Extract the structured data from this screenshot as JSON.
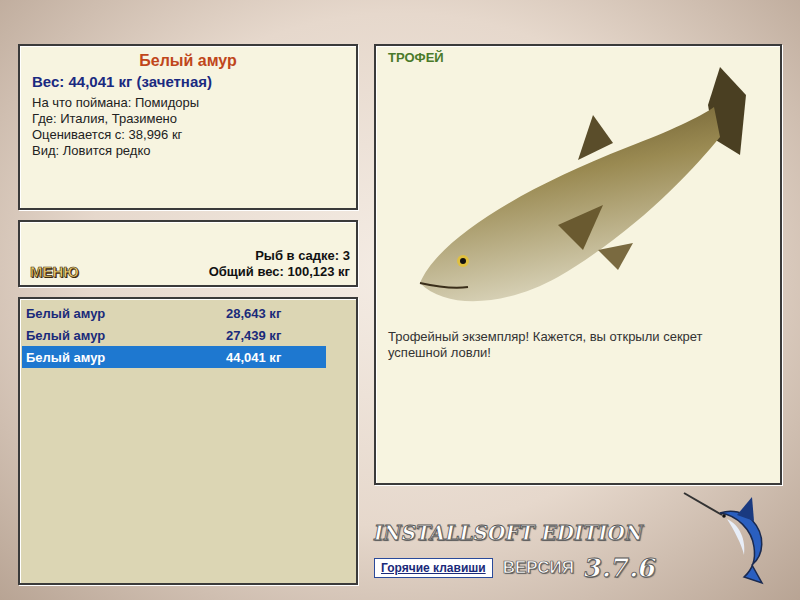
{
  "info": {
    "title": "Белый амур",
    "weight": "Вес: 44,041 кг (зачетная)",
    "details": [
      "На что поймана: Помидоры",
      "Где: Италия, Тразимено",
      "Оценивается с: 38,996 кг",
      "Вид: Ловится редко"
    ]
  },
  "menu": {
    "label": "МЕНЮ",
    "count": "Рыб в садке: 3",
    "total": "Общий вес: 100,123 кг"
  },
  "catch_list": [
    {
      "name": "Белый амур",
      "weight": "28,643 кг",
      "selected": false
    },
    {
      "name": "Белый амур",
      "weight": "27,439 кг",
      "selected": false
    },
    {
      "name": "Белый амур",
      "weight": "44,041 кг",
      "selected": true
    }
  ],
  "trophy": {
    "badge": "ТРОФЕЙ",
    "message": "Трофейный экземпляр! Кажется, вы открыли секрет успешной ловли!"
  },
  "footer": {
    "edition": "INSTALLSOFT EDITION",
    "version_label": "ВЕРСИЯ",
    "version": "3.7.6",
    "hotkeys": "Горячие клавиши"
  }
}
